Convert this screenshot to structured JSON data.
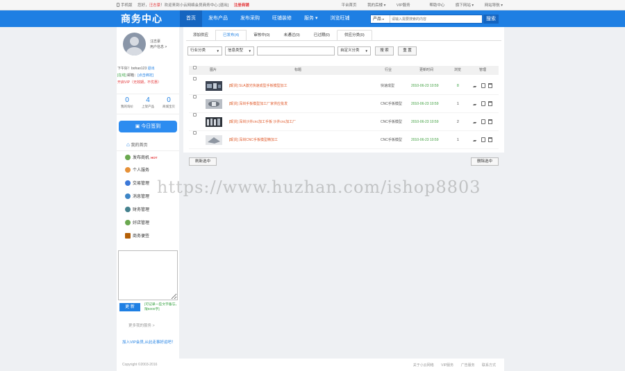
{
  "topbar": {
    "phone": "手机版",
    "hello": "您好，",
    "user": "汪志豪",
    "welcome": "！欢迎来到小云网络会员商务中心",
    "logout": "[退出]",
    "register": "注册商铺",
    "links": [
      "平台首页",
      "我的后楼 ▾",
      "VIP服务",
      "帮助中心",
      "旗下网站 ▾",
      "网站导航 ▾"
    ]
  },
  "nav": {
    "logo": "商务中心",
    "items": [
      "首页",
      "发布产品",
      "发布采购",
      "旺铺装修",
      "服务 ▾",
      "浏览旺铺"
    ],
    "active_index": 0,
    "search_category": "产品",
    "search_placeholder": "请输入需要搜索的内容",
    "search_button": "搜索"
  },
  "sidebar": {
    "username": "汪志豪",
    "user_center": "用户信息 >",
    "greeting": "下午好！bohao123",
    "exit": "退出",
    "status_online": "[在线]",
    "email_label": "邮箱：",
    "email_status": "[点击绑定]",
    "vip_status": "开启VIP（无效期，不优惠）",
    "stats": [
      {
        "num": "0",
        "label": "我的询价"
      },
      {
        "num": "4",
        "label": "上架产品"
      },
      {
        "num": "0",
        "label": "商城宝贝"
      }
    ],
    "signin": "今日签到",
    "home": "我的首页",
    "menu": [
      {
        "label": "发布商机",
        "color": "#6aa84f",
        "hot": "HOT"
      },
      {
        "label": "个人服务",
        "color": "#e69138",
        "hot": ""
      },
      {
        "label": "交易管理",
        "color": "#3c78d8",
        "hot": ""
      },
      {
        "label": "消息管理",
        "color": "#3d85c6",
        "hot": ""
      },
      {
        "label": "财务管理",
        "color": "#45818e",
        "hot": ""
      },
      {
        "label": "好店管理",
        "color": "#6aa84f",
        "hot": ""
      },
      {
        "label": "商务便签",
        "color": "#b45f06",
        "hot": ""
      }
    ],
    "note_button": "更 新",
    "note_tip": "[可记录一些文字备忘，限5000字]",
    "more_services": "更多我的服务 >",
    "vip_ad": "加入VIP会员,从此走事好运吧！"
  },
  "main": {
    "tabs": [
      "添加供应",
      "已发布(4)",
      "审核中(0)",
      "未通过(0)",
      "已过期(0)",
      "供应分类(0)"
    ],
    "active_tab": 1,
    "filters": {
      "industry": "行业分类",
      "info_type": "信息类型",
      "keyword": "",
      "custom": "自定义分类",
      "search": "搜 索",
      "reset": "重 置"
    },
    "columns": [
      "图片",
      "标题",
      "行业",
      "更新时间",
      "浏览",
      "管理"
    ],
    "rows": [
      {
        "title": "[现货] SLA激光快速成型手板模型加工",
        "industry": "快速成型",
        "time": "2010-06-23 10:59",
        "views": "8",
        "views_green": true
      },
      {
        "title": "[现货] 深圳手板模型加工厂家供应批发",
        "industry": "CNC手板模型",
        "time": "2010-06-23 10:59",
        "views": "1",
        "views_green": false
      },
      {
        "title": "[现货] 深圳沙井cnc加工手板 沙井cnc加工厂",
        "industry": "CNC手板模型",
        "time": "2010-06-23 10:59",
        "views": "2",
        "views_green": false
      },
      {
        "title": "[现货] 深圳CNC手板模型精加工",
        "industry": "CNC手板模型",
        "time": "2010-06-23 10:59",
        "views": "1",
        "views_green": false
      }
    ],
    "refresh_button": "刷新选中",
    "delete_button": "删除选中"
  },
  "watermark": "https://www.huzhan.com/ishop8803",
  "footer": {
    "copyright": "Copyright ©2003-2016",
    "links": [
      "关于小云网络",
      "VIP服务",
      "广告服务",
      "联系方式"
    ]
  }
}
